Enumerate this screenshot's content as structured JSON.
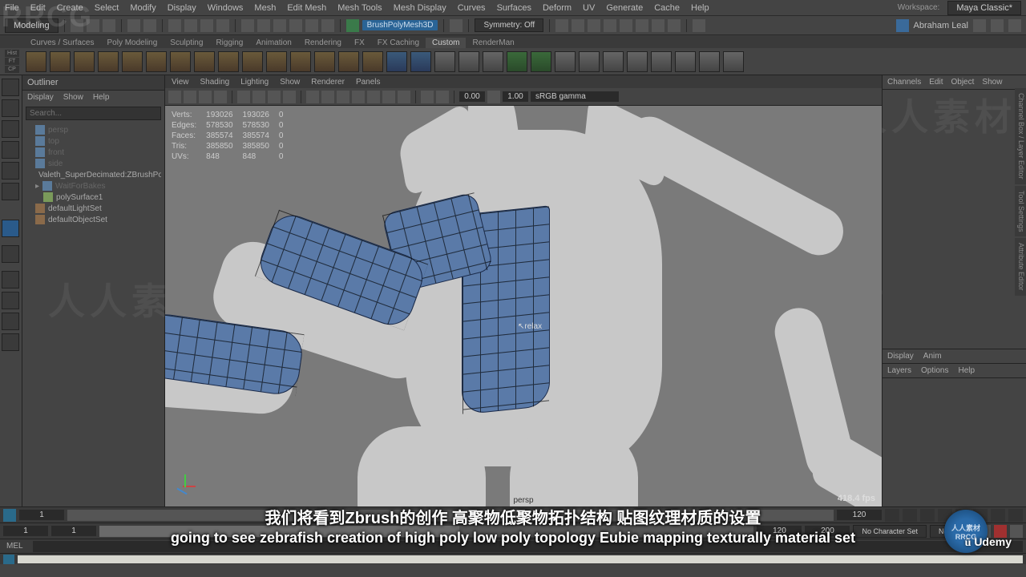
{
  "menubar": [
    "File",
    "Edit",
    "Create",
    "Select",
    "Modify",
    "Display",
    "Windows",
    "Mesh",
    "Edit Mesh",
    "Mesh Tools",
    "Mesh Display",
    "Curves",
    "Surfaces",
    "Deform",
    "UV",
    "Generate",
    "Cache",
    "Help"
  ],
  "workspace_label": "Workspace:",
  "workspace_value": "Maya Classic*",
  "mode_dropdown": "Modeling",
  "live_surface": "BrushPolyMesh3D",
  "symmetry_label": "Symmetry: Off",
  "account": "Abraham Leal",
  "shelf_tabs": [
    "Curves / Surfaces",
    "Poly Modeling",
    "Sculpting",
    "Rigging",
    "Animation",
    "Rendering",
    "FX",
    "FX Caching",
    "Custom",
    "RenderMan"
  ],
  "shelf_active": "Custom",
  "shelf_small": [
    "Hist",
    "FT",
    "CP"
  ],
  "outliner": {
    "title": "Outliner",
    "menu": [
      "Display",
      "Show",
      "Help"
    ],
    "search_placeholder": "Search...",
    "items": [
      {
        "label": "persp",
        "dim": true,
        "indent": 1
      },
      {
        "label": "top",
        "dim": true,
        "indent": 1
      },
      {
        "label": "front",
        "dim": true,
        "indent": 1
      },
      {
        "label": "side",
        "dim": true,
        "indent": 1
      },
      {
        "label": "Valeth_SuperDecimated:ZBrushPolyM",
        "dim": false,
        "indent": 1
      },
      {
        "label": "WaitForBakes",
        "dim": true,
        "indent": 1
      },
      {
        "label": "polySurface1",
        "dim": false,
        "indent": 2
      },
      {
        "label": "defaultLightSet",
        "dim": false,
        "indent": 1
      },
      {
        "label": "defaultObjectSet",
        "dim": false,
        "indent": 1
      }
    ]
  },
  "viewport": {
    "menu": [
      "View",
      "Shading",
      "Lighting",
      "Show",
      "Renderer",
      "Panels"
    ],
    "field1": "0.00",
    "field2": "1.00",
    "color_mgmt": "sRGB gamma",
    "camera_label": "persp",
    "fps": "418.4 fps",
    "cursor_hint": "relax"
  },
  "hud": {
    "rows": [
      [
        "Verts:",
        "193026",
        "193026",
        "0"
      ],
      [
        "Edges:",
        "578530",
        "578530",
        "0"
      ],
      [
        "Faces:",
        "385574",
        "385574",
        "0"
      ],
      [
        "Tris:",
        "385850",
        "385850",
        "0"
      ],
      [
        "UVs:",
        "848",
        "848",
        "0"
      ]
    ]
  },
  "right_panel": {
    "tabs_top": [
      "Channels",
      "Edit",
      "Object",
      "Show"
    ],
    "tabs_mid": [
      "Display",
      "Anim"
    ],
    "tabs_bot": [
      "Layers",
      "Options",
      "Help"
    ],
    "side_tabs": [
      "Channel Box / Layer Editor",
      "",
      "Attribute Editor"
    ]
  },
  "timeline": {
    "start1": "1",
    "start2": "1",
    "end1": "120",
    "end2": "200",
    "char_set": "No Character Set",
    "anim_layer": "No Anim",
    "ticks": [
      "1",
      "120"
    ]
  },
  "cmd_label": "MEL",
  "subtitles": {
    "cn": "我们将看到Zbrush的创作 高聚物低聚物拓扑结构 贴图纹理材质的设置",
    "en": "going to see zebrafish creation of high poly low poly topology Eubie mapping texturally material set"
  },
  "watermark_text": "人人素材",
  "rrcg": "RRCG",
  "udemy": "Udemy"
}
